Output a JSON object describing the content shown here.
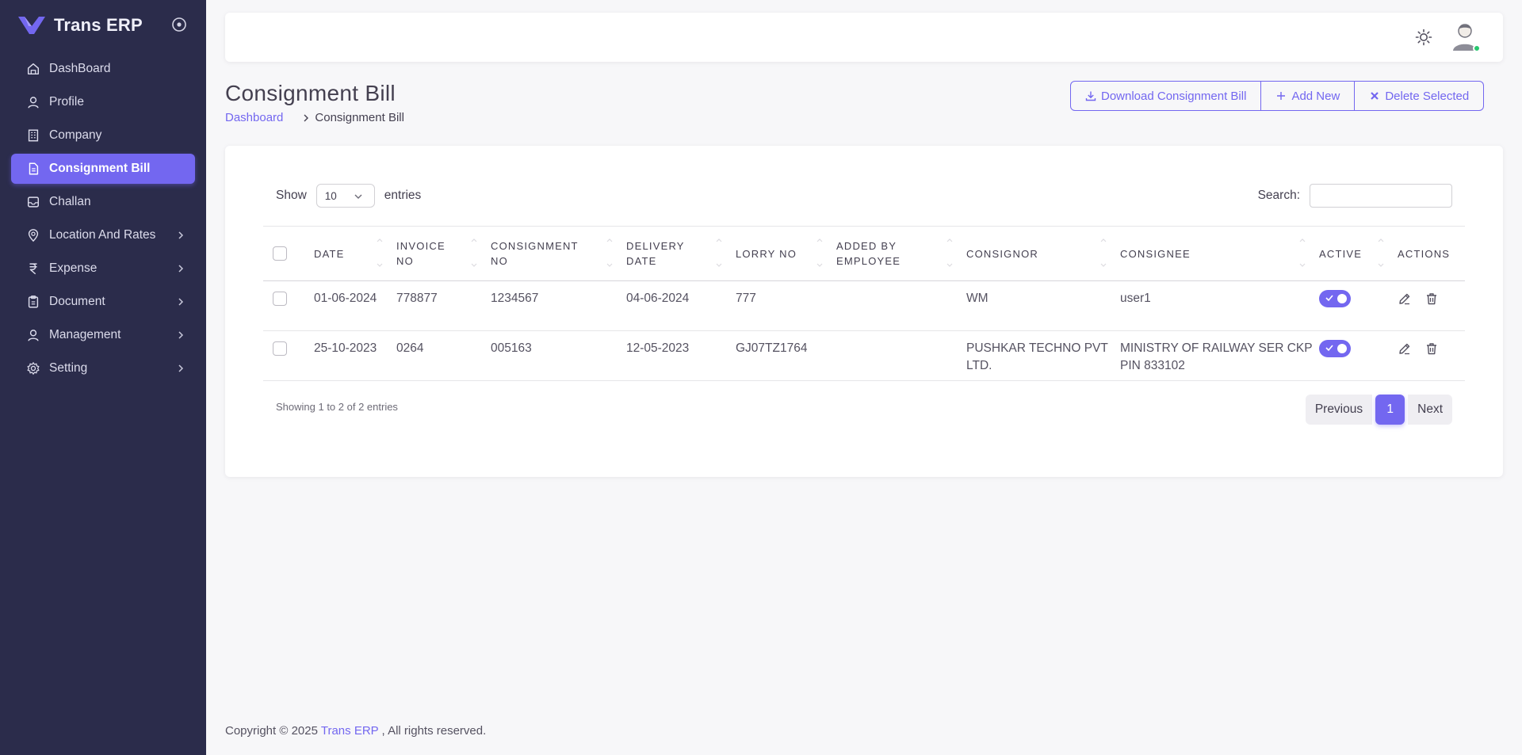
{
  "brand": {
    "name": "Trans ERP"
  },
  "sidebar": {
    "items": [
      {
        "label": "DashBoard",
        "icon": "home-icon"
      },
      {
        "label": "Profile",
        "icon": "user-icon"
      },
      {
        "label": "Company",
        "icon": "building-icon"
      },
      {
        "label": "Consignment Bill",
        "icon": "file-icon",
        "active": true
      },
      {
        "label": "Challan",
        "icon": "inbox-icon"
      },
      {
        "label": "Location And Rates",
        "icon": "map-pin-icon",
        "submenu": true
      },
      {
        "label": "Expense",
        "icon": "rupee-icon",
        "submenu": true
      },
      {
        "label": "Document",
        "icon": "document-icon",
        "submenu": true
      },
      {
        "label": "Management",
        "icon": "user-icon",
        "submenu": true
      },
      {
        "label": "Setting",
        "icon": "gear-icon",
        "submenu": true
      }
    ]
  },
  "header": {
    "title": "Consignment Bill",
    "breadcrumb": {
      "home": "Dashboard",
      "current": "Consignment Bill"
    },
    "buttons": {
      "download": "Download Consignment Bill",
      "add": "Add New",
      "delete": "Delete Selected"
    }
  },
  "table_controls": {
    "show_label": "Show",
    "page_length": "10",
    "entries_label": "entries",
    "search_label": "Search:",
    "search_value": ""
  },
  "table": {
    "columns": [
      "Date",
      "Invoice No",
      "Consignment No",
      "Delivery Date",
      "Lorry No",
      "Added By Employee",
      "Consignor",
      "Consignee",
      "Active",
      "Actions"
    ],
    "rows": [
      {
        "date": "01-06-2024",
        "invoice": "778877",
        "consignment": "1234567",
        "delivery": "04-06-2024",
        "lorry": "777",
        "employee": "",
        "consignor": "WM",
        "consignee": "user1",
        "active": true
      },
      {
        "date": "25-10-2023",
        "invoice": "0264",
        "consignment": "005163",
        "delivery": "12-05-2023",
        "lorry": "GJ07TZ1764",
        "employee": "",
        "consignor": "PUSHKAR TECHNO PVT LTD.",
        "consignee": "MINISTRY OF RAILWAY SER CKP PIN 833102",
        "active": true
      }
    ]
  },
  "pagination": {
    "info": "Showing 1 to 2 of 2 entries",
    "previous": "Previous",
    "current": "1",
    "next": "Next"
  },
  "footer": {
    "prefix": "Copyright © 2025 ",
    "link": "Trans ERP",
    "suffix": " , All rights reserved."
  },
  "colors": {
    "primary": "#7367f0",
    "sidebar": "#2b2c4b",
    "background": "#f7f7f9",
    "online": "#28c76f"
  }
}
